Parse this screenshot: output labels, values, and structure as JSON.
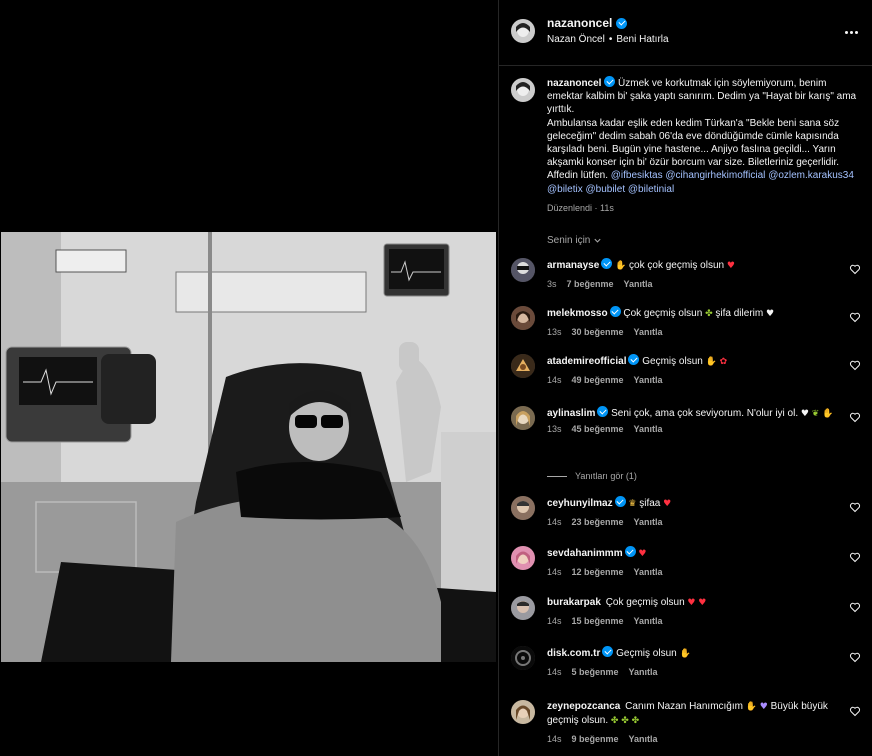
{
  "post": {
    "username": "nazanoncel",
    "full_name": "Nazan Öncel",
    "audio": "Beni Hatırla",
    "caption_lines": [
      "Üzmek ve korkutmak için söylemiyorum, benim emektar kalbim bi' şaka yaptı sanırım. Dedim ya \"Hayat bir karış\" ama yırttık.",
      "Ambulansa kadar eşlik eden kedim Türkan'a \"Bekle beni sana söz geleceğim\" dedim sabah 06'da eve döndüğümde cümle kapısında karşıladı beni. Bugün yine hastene... Anjiyo faslına geçildi... Yarın akşamki konser için bi' özür borcum var size. Biletleriniz geçerlidir. Affedin lütfen."
    ],
    "mentions": [
      "@ifbesiktas",
      "@cihangirhekimofficial",
      "@ozlem.karakus34",
      "@biletix",
      "@bubilet",
      "@biletinial"
    ],
    "edited_label": "Düzenlendi",
    "time": "11s"
  },
  "sort_label": "Senin için",
  "view_replies_label": "Yanıtları gör (1)",
  "reply_label": "Yanıtla",
  "comments": [
    {
      "user": "armanayse",
      "text": "çok çok geçmiş olsun",
      "time": "3s",
      "likes": "7 beğenme"
    },
    {
      "user": "melekmosso",
      "text": "Çok geçmiş olsun",
      "text2": "şifa dilerim",
      "time": "13s",
      "likes": "30 beğenme"
    },
    {
      "user": "atademireofficial",
      "text": "Geçmiş olsun",
      "time": "14s",
      "likes": "49 beğenme"
    },
    {
      "user": "aylinaslim",
      "text": "Seni çok, ama çok seviyorum. N'olur iyi ol.",
      "time": "13s",
      "likes": "45 beğenme"
    },
    {
      "user": "ceyhunyilmaz",
      "text": "şifaa",
      "time": "14s",
      "likes": "23 beğenme"
    },
    {
      "user": "sevdahanimmm",
      "text": "",
      "time": "14s",
      "likes": "12 beğenme"
    },
    {
      "user": "burakarpak",
      "text": "Çok geçmiş olsun",
      "time": "14s",
      "likes": "15 beğenme"
    },
    {
      "user": "disk.com.tr",
      "text": "Geçmiş olsun",
      "time": "14s",
      "likes": "5 beğenme"
    },
    {
      "user": "zeynepozcanca",
      "text": "Canım Nazan Hanımcığım",
      "text2": "Büyük büyük geçmiş olsun.",
      "time": "14s",
      "likes": "9 beğenme"
    }
  ],
  "icons": {
    "verified": "verified-badge-icon",
    "more": "more-options-icon",
    "heart": "heart-outline-icon",
    "chevron": "chevron-down-icon"
  },
  "colors": {
    "background": "#000000",
    "text": "#f5f5f5",
    "muted": "#a8a8a8",
    "link": "#a4c2ff",
    "verified": "#0095f6"
  }
}
